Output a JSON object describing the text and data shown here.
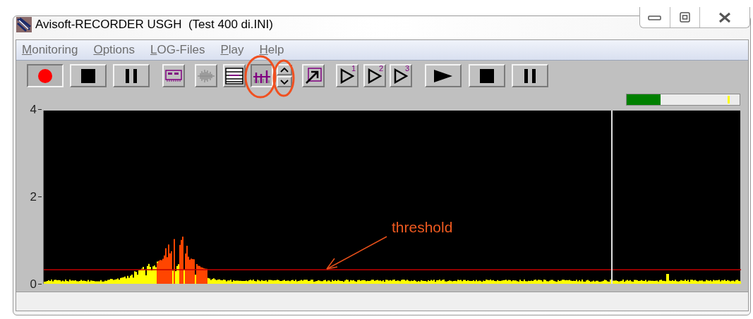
{
  "window": {
    "title": "Avisoft-RECORDER USGH  (Test 400 di.INI)"
  },
  "menu": [
    {
      "label": "Monitoring"
    },
    {
      "label": "Options"
    },
    {
      "label": "LOG-Files"
    },
    {
      "label": "Play"
    },
    {
      "label": "Help"
    }
  ],
  "toolbar": [
    {
      "kind": "record",
      "pressed": true
    },
    {
      "kind": "stop",
      "pressed": false
    },
    {
      "kind": "pause",
      "pressed": false
    },
    {
      "kind": "card",
      "pressed": false
    },
    {
      "kind": "wave",
      "pressed": false
    },
    {
      "kind": "list",
      "pressed": false
    },
    {
      "kind": "histogram",
      "pressed": true
    },
    {
      "kind": "updown",
      "pressed": false
    },
    {
      "kind": "arrow",
      "pressed": false
    },
    {
      "kind": "slot",
      "label": "1",
      "pressed": false
    },
    {
      "kind": "slot",
      "label": "2",
      "pressed": false
    },
    {
      "kind": "slot",
      "label": "3",
      "pressed": false
    },
    {
      "kind": "play",
      "pressed": false
    },
    {
      "kind": "stop",
      "pressed": false
    },
    {
      "kind": "pause",
      "pressed": false
    }
  ],
  "level_meter": {
    "level": 0.3
  },
  "plot": {
    "y_tick_labels": [
      "4",
      "2",
      "0"
    ]
  },
  "annotation": {
    "label": "threshold"
  }
}
